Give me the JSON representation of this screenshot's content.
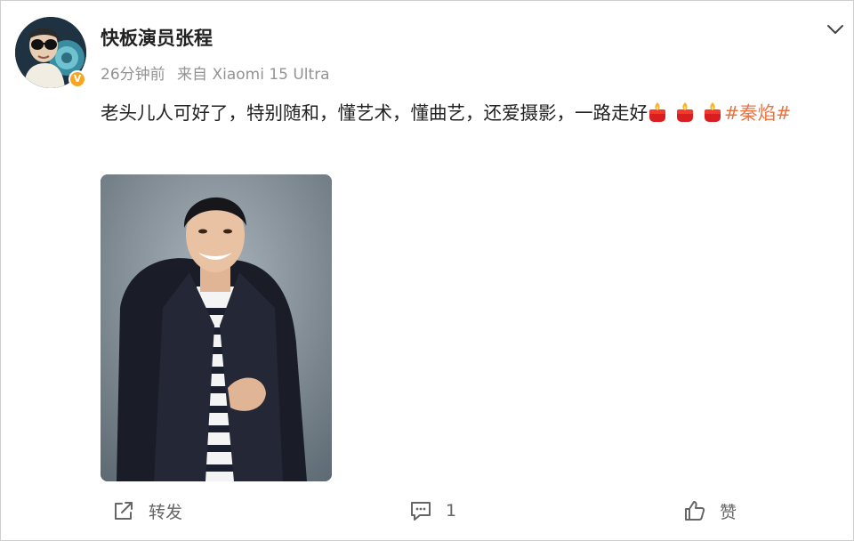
{
  "user": {
    "name": "快板演员张程",
    "avatar_icon": "avatar-photo",
    "verified_badge": "V"
  },
  "meta": {
    "time": "26分钟前",
    "source": "来自 Xiaomi 15 Ultra"
  },
  "post": {
    "text": "老头儿人可好了，特别随和，懂艺术，懂曲艺，还爱摄影，一路走好",
    "emoji_icon": "fire-icon",
    "emoji_count": 3,
    "hashtag": "#秦焰#"
  },
  "actions": {
    "repost_label": "转发",
    "comment_count": "1",
    "like_label": "赞"
  },
  "colors": {
    "hashtag": "#eb7340",
    "meta": "#939393",
    "badge": "#f6a623"
  }
}
